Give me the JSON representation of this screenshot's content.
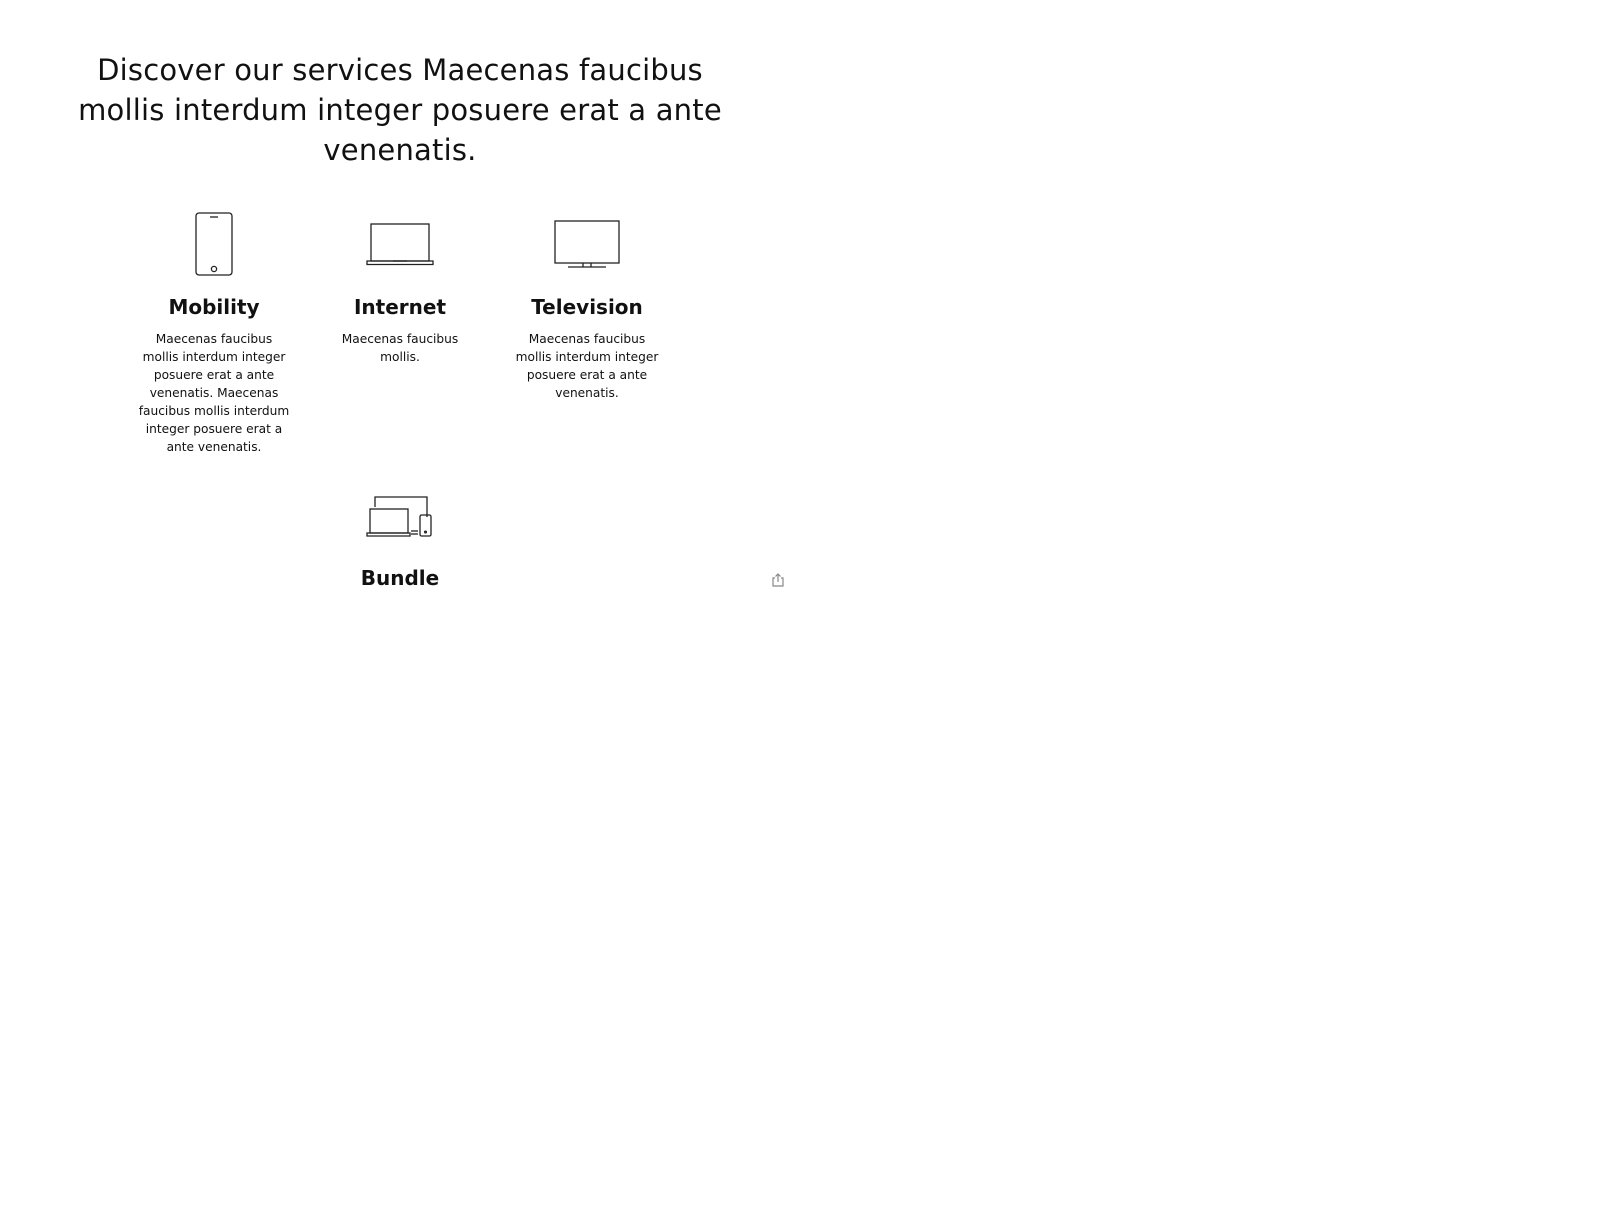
{
  "headline": "Discover our services Maecenas faucibus mollis interdum integer posuere erat a ante venenatis.",
  "services": [
    {
      "icon": "smartphone-icon",
      "title": "Mobility",
      "description": "Maecenas faucibus mollis interdum integer posuere erat a ante venenatis. Maecenas faucibus mollis interdum integer posuere erat a ante venenatis."
    },
    {
      "icon": "laptop-icon",
      "title": "Internet",
      "description": "Maecenas faucibus mollis."
    },
    {
      "icon": "television-icon",
      "title": "Television",
      "description": "Maecenas faucibus mollis interdum integer posuere erat a ante venenatis."
    },
    {
      "icon": "devices-bundle-icon",
      "title": "Bundle",
      "description": ""
    }
  ],
  "share": {
    "icon": "share-icon"
  },
  "colors": {
    "text": "#111111",
    "background": "#ffffff",
    "icon_stroke": "#222222",
    "share_icon": "#888888"
  }
}
